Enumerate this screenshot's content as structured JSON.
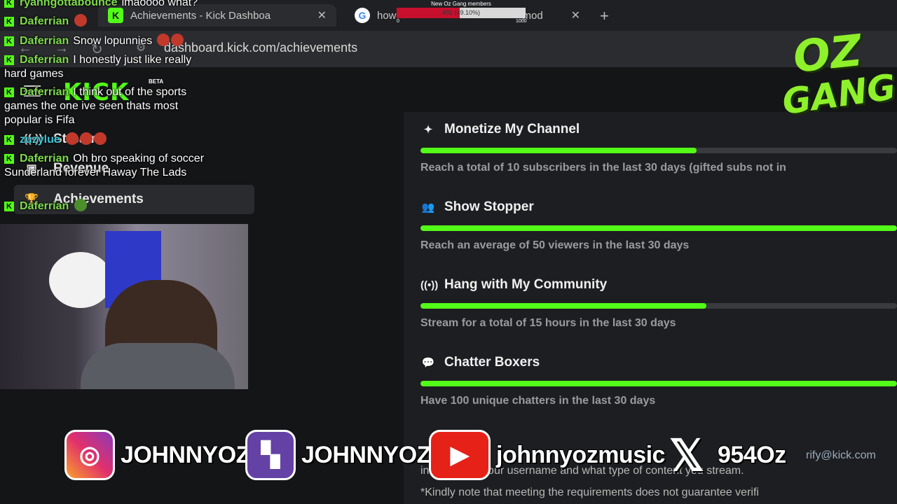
{
  "browser": {
    "tabs": [
      {
        "label": "Achievements - Kick Dashboa",
        "favicon": "kick-icon",
        "active": true
      },
      {
        "label": "how",
        "label_suffix": "mod",
        "favicon": "google-icon",
        "active": false
      }
    ],
    "url": "dashboard.kick.com/achievements"
  },
  "goal": {
    "title": "New Oz Gang members",
    "value_text": "491 (49.10%)",
    "progress": 0.491,
    "min": "0",
    "max": "1000"
  },
  "sidebar": {
    "logo": "KICK",
    "beta": "BETA",
    "items": [
      {
        "label": "Stream",
        "icon": "broadcast-icon"
      },
      {
        "label": "Revenue",
        "icon": "revenue-icon"
      },
      {
        "label": "Achievements",
        "icon": "trophy-icon",
        "active": true
      }
    ]
  },
  "achievements": [
    {
      "title": "Monetize My Channel",
      "icon": "sparkle-icon",
      "progress": 0.58,
      "desc": "Reach a total of 10 subscribers in the last 30 days (gifted subs not in"
    },
    {
      "title": "Show Stopper",
      "icon": "users-icon",
      "progress": 1.0,
      "desc": "Reach an average of 50 viewers in the last 30 days"
    },
    {
      "title": "Hang with My Community",
      "icon": "broadcast-icon",
      "progress": 0.6,
      "desc": "Stream for a total of 15 hours in the last 30 days"
    },
    {
      "title": "Chatter Boxers",
      "icon": "chat-icon",
      "progress": 1.0,
      "desc": "Have 100 unique chatters in the last 30 days"
    }
  ],
  "footnotes": [
    "rify@kick.com",
    "information: your username and what type of content you stream.",
    "*Kindly note that meeting the requirements does not guarantee verifi"
  ],
  "chat": [
    {
      "user": "ryanngottabounce",
      "text": "lmaoooo what?"
    },
    {
      "user": "Daferrian",
      "text": ""
    },
    {
      "user": "Daferrian",
      "text": "Snow lopunnies"
    },
    {
      "user": "Daferrian",
      "text": "I honestly just like really hard games"
    },
    {
      "user": "Daferrian",
      "text": "I think out of the sports games the one ive seen thats most popular is Fifa"
    },
    {
      "user": "zuzylue",
      "text": ""
    },
    {
      "user": "Daferrian",
      "text": "Oh bro speaking of soccer Sunderland forever Haway The Lads"
    },
    {
      "user": "Daferrian",
      "text": ""
    }
  ],
  "overlay_logo": {
    "line1": "OZ",
    "line2": "GANG"
  },
  "socials": [
    {
      "platform": "instagram",
      "icon": "instagram-icon",
      "handle": "JOHNNYOZ"
    },
    {
      "platform": "twitch",
      "icon": "twitch-icon",
      "handle": "JOHNNYOZ"
    },
    {
      "platform": "youtube",
      "icon": "youtube-icon",
      "handle": "johnnyozmusic"
    },
    {
      "platform": "x",
      "icon": "x-icon",
      "handle": "954Oz"
    }
  ],
  "colors": {
    "kick_green": "#53fc18",
    "goal_red": "#c8102e",
    "logo_green": "#8ef02a"
  }
}
